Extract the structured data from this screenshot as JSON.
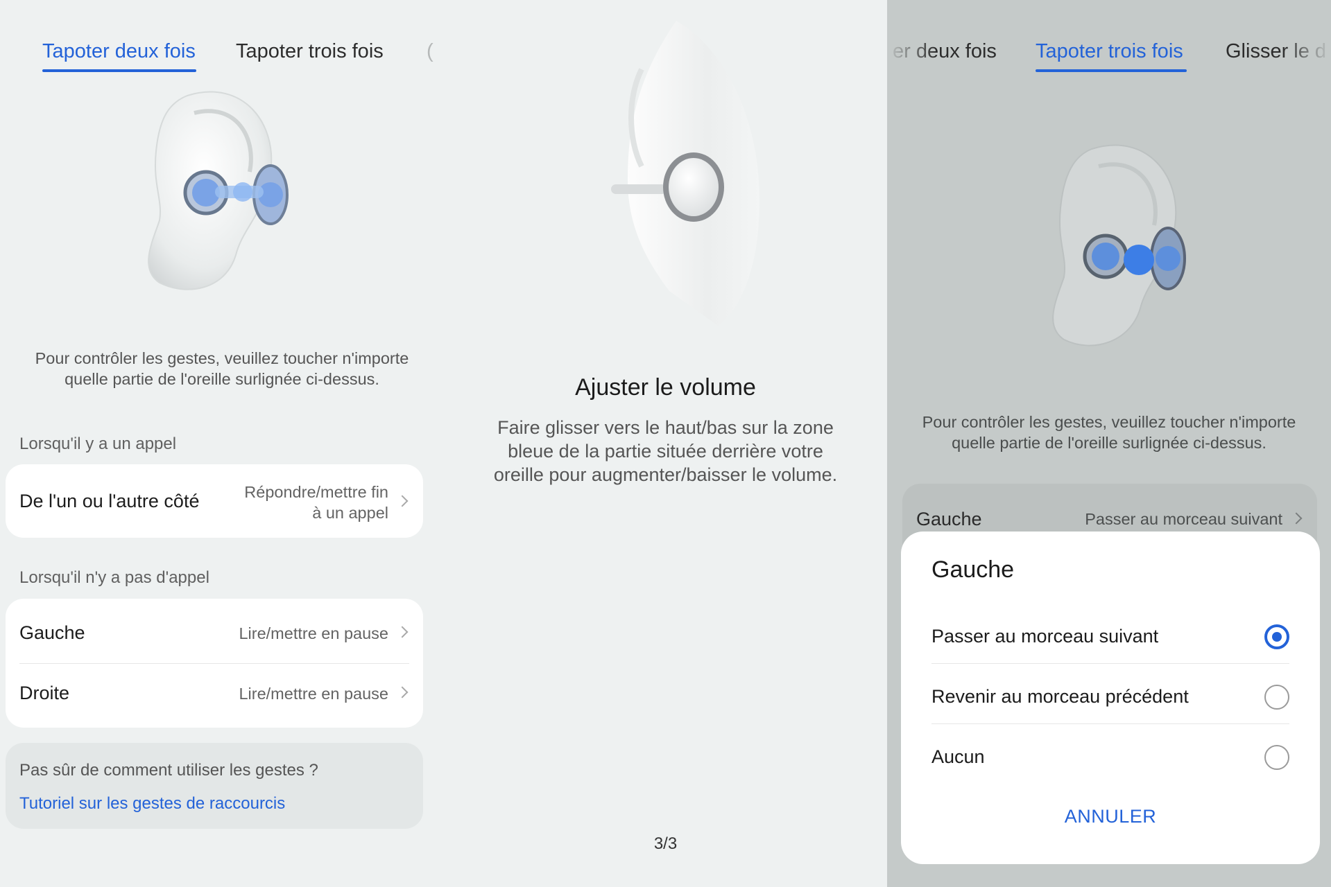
{
  "panel1": {
    "tabs": [
      {
        "label": "Tapoter deux fois",
        "active": true
      },
      {
        "label": "Tapoter trois fois",
        "active": false
      },
      {
        "label": "(",
        "active": false
      }
    ],
    "hint": [
      "Pour contrôler les gestes, veuillez toucher n'importe",
      "quelle partie de l'oreille surlignée ci-dessus."
    ],
    "call_section": "Lorsqu'il y a un appel",
    "call_row": {
      "title": "De l'un ou l'autre côté",
      "value": [
        "Répondre/mettre fin",
        "à un appel"
      ]
    },
    "nocall_section": "Lorsqu'il n'y a pas d'appel",
    "nocall_rows": [
      {
        "title": "Gauche",
        "value": "Lire/mettre en pause"
      },
      {
        "title": "Droite",
        "value": "Lire/mettre en pause"
      }
    ],
    "help": {
      "question": "Pas sûr de comment utiliser les gestes ?",
      "link": "Tutoriel sur les gestes de raccourcis"
    }
  },
  "panel2": {
    "title": "Ajuster le volume",
    "description": [
      "Faire glisser vers le haut/bas sur la zone",
      "bleue de la partie située derrière votre",
      "oreille pour augmenter/baisser le volume."
    ],
    "page_indicator": "3/3"
  },
  "panel3": {
    "tabs": [
      {
        "label": "er deux fois",
        "active": false
      },
      {
        "label": "Tapoter trois fois",
        "active": true
      },
      {
        "label": "Glisser le d",
        "active": false
      }
    ],
    "hint": [
      "Pour contrôler les gestes, veuillez toucher n'importe",
      "quelle partie de l'oreille surlignée ci-dessus."
    ],
    "row": {
      "title": "Gauche",
      "value": "Passer au morceau suivant"
    },
    "modal": {
      "title": "Gauche",
      "options": [
        {
          "label": "Passer au morceau suivant",
          "selected": true
        },
        {
          "label": "Revenir au morceau précédent",
          "selected": false
        },
        {
          "label": "Aucun",
          "selected": false
        }
      ],
      "cancel": "ANNULER"
    }
  },
  "colors": {
    "accent": "#2362d8",
    "background": "#eef1f1",
    "overlay": "#c5cac9",
    "card": "#ffffff"
  },
  "icons": [
    "ear-earbud-illustration",
    "chevron-right-icon",
    "radio-selected-icon",
    "radio-unselected-icon"
  ]
}
